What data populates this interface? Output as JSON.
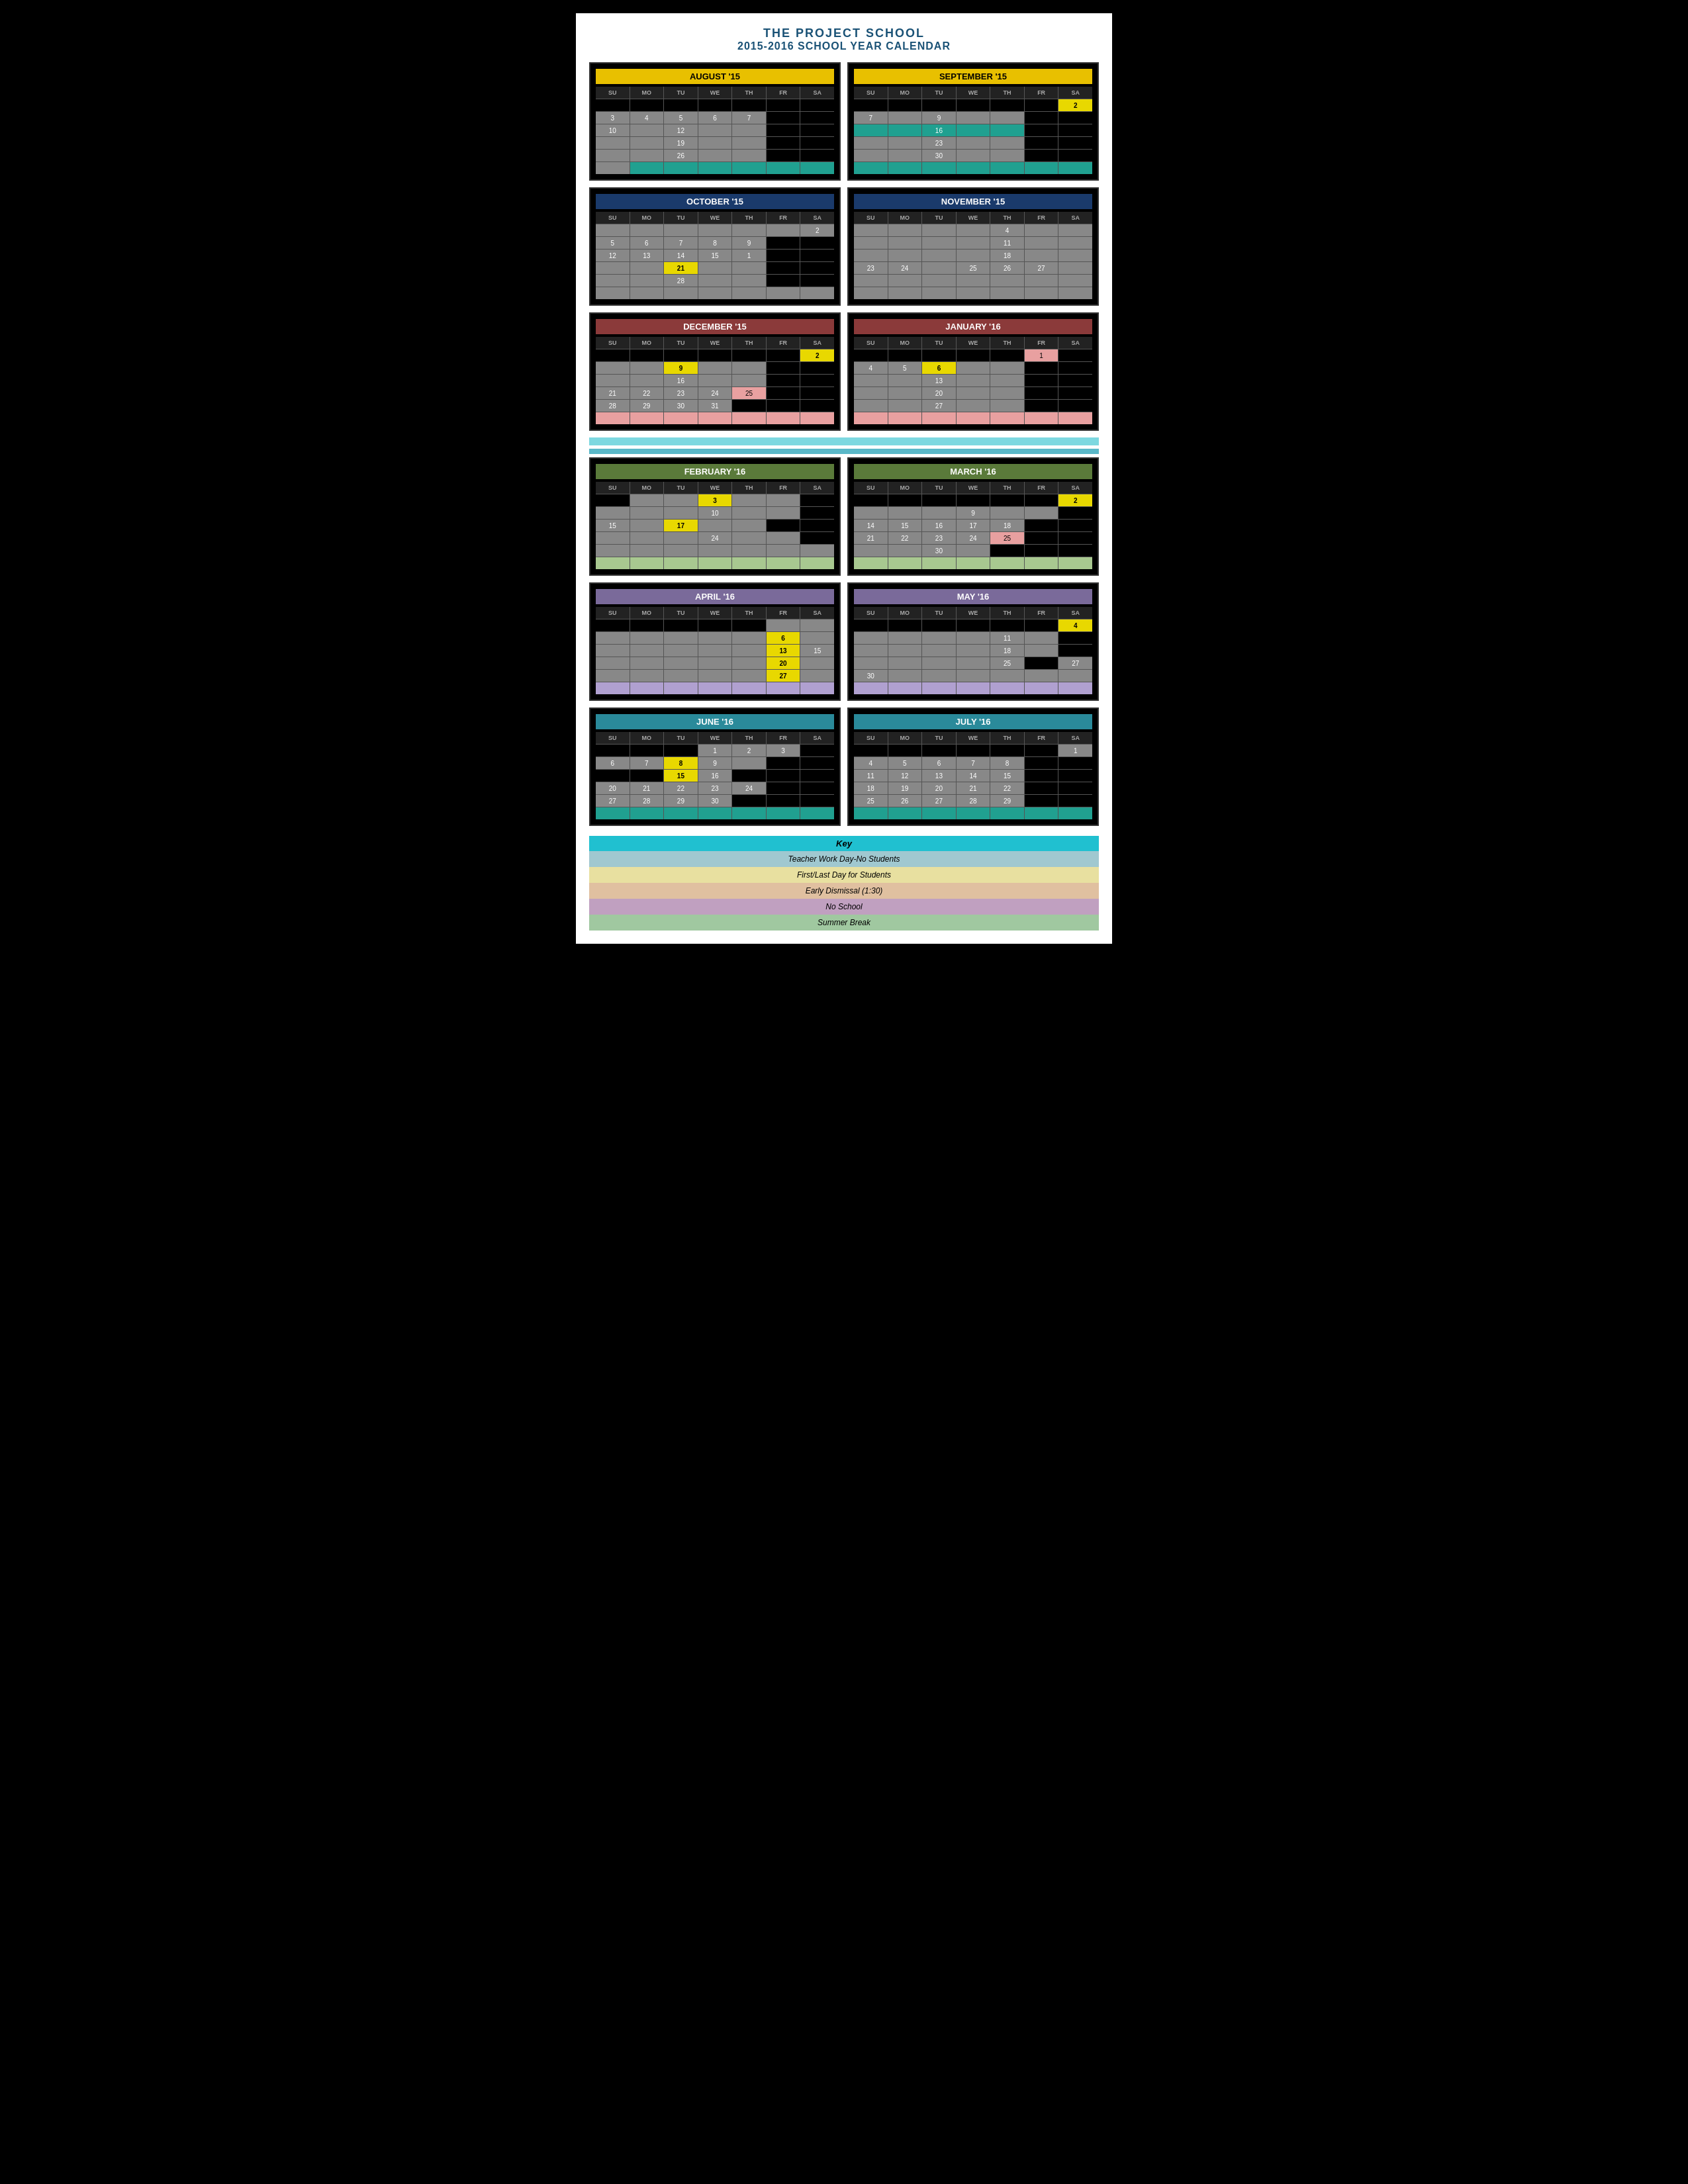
{
  "header": {
    "title": "THE PROJECT SCHOOL",
    "subtitle": "2015-2016 SCHOOL YEAR CALENDAR"
  },
  "legend": {
    "key_label": "Key",
    "items": [
      {
        "label": "Teacher Work Day-No Students",
        "class": "legend-teacher"
      },
      {
        "label": "First/Last Day for Students",
        "class": "legend-firstlast"
      },
      {
        "label": "Early Dismissal (1:30)",
        "class": "legend-early"
      },
      {
        "label": "No School",
        "class": "legend-noschool"
      },
      {
        "label": "Summer Break",
        "class": "legend-summer"
      }
    ]
  }
}
